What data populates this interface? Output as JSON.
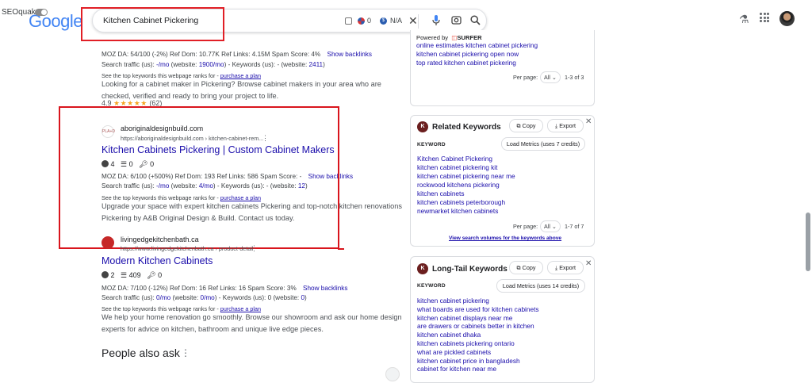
{
  "header": {
    "seoquake_label": "SEOquake",
    "logo_text": "Google",
    "search_query": "Kitchen Cabinet Pickering",
    "pill_count_a": "0",
    "pill_count_b": "N/A"
  },
  "results": {
    "top_partial": {
      "meta_line": "MOZ DA: 54/100 (-2%)   Ref Dom: 10.77K   Ref Links: 4.15M   Spam Score: 4%",
      "show_backlinks": "Show backlinks",
      "traffic_prefix": "Search traffic (us): ",
      "traffic_value": "-/mo",
      "traffic_mid": " (website: ",
      "traffic_website": "1900/mo",
      "traffic_kw": ") - Keywords (us): - (website: ",
      "traffic_kw_value": "2411",
      "traffic_end": ")",
      "top_kw_text": "See the top keywords this webpage ranks for - ",
      "purchase_plan": "purchase a plan",
      "snippet": "Looking for a cabinet maker in Pickering? Browse cabinet makers in your area who are checked, verified and ready to bring your project to life.",
      "rating_value": "4.9",
      "rating_stars": "★★★★★",
      "rating_count": "(62)"
    },
    "aboriginal": {
      "favicon_text": "PLA+D",
      "site_name": "aboriginaldesignbuild.com",
      "site_url": "https://aboriginaldesignbuild.com › kitchen-cabinet-rem...",
      "title": "Kitchen Cabinets Pickering | Custom Cabinet Makers",
      "icon_count_a": "4",
      "icon_count_b": "0",
      "icon_count_c": "0",
      "meta_line": "MOZ DA: 6/100 (+500%)   Ref Dom: 193   Ref Links: 586   Spam Score: -",
      "show_backlinks": "Show backlinks",
      "traffic_prefix": "Search traffic (us): ",
      "traffic_value": "-/mo",
      "traffic_mid": " (website: ",
      "traffic_website": "4/mo",
      "traffic_kw": ") - Keywords (us): - (website: ",
      "traffic_kw_value": "12",
      "traffic_end": ")",
      "top_kw_text": "See the top keywords this webpage ranks for - ",
      "purchase_plan": "purchase a plan",
      "snippet": "Upgrade your space with expert kitchen cabinets Pickering and top-notch kitchen renovations Pickering by A&B Original Design & Build. Contact us today."
    },
    "livingedge": {
      "site_name": "livingedgekitchenbath.ca",
      "site_url": "https://www.livingedgekitchenbath.ca › product-detail",
      "title": "Modern Kitchen Cabinets",
      "icon_count_a": "2",
      "icon_count_b": "409",
      "icon_count_c": "0",
      "meta_line": "MOZ DA: 7/100 (-12%)   Ref Dom: 16   Ref Links: 16   Spam Score: 3%",
      "show_backlinks": "Show backlinks",
      "traffic_prefix": "Search traffic (us): ",
      "traffic_value": "0/mo",
      "traffic_mid": " (website: ",
      "traffic_website": "0/mo",
      "traffic_kw": ") - Keywords (us): 0 (website: ",
      "traffic_kw_value": "0",
      "traffic_end": ")",
      "top_kw_text": "See the top keywords this webpage ranks for - ",
      "purchase_plan": "purchase a plan",
      "snippet": "We help your home renovation go smoothly. Browse our showroom and ask our home design experts for advice on kitchen, bathroom and unique live edge pieces."
    },
    "people_also_ask": "People also ask"
  },
  "sidebar": {
    "top_panel": {
      "powered_by": "Powered by",
      "surfer": "SURFER",
      "keywords": [
        "online estimates kitchen cabinet pickering",
        "kitchen cabinet pickering open now",
        "top rated kitchen cabinet pickering"
      ],
      "per_page_label": "Per page:",
      "per_page_value": "All",
      "range": "1-3 of 3"
    },
    "related": {
      "badge": "K",
      "title": "Related Keywords",
      "copy": "Copy",
      "export": "Export",
      "column": "KEYWORD",
      "load_metrics": "Load Metrics (uses 7 credits)",
      "keywords": [
        "Kitchen Cabinet Pickering",
        "kitchen cabinet pickering kit",
        "kitchen cabinet pickering near me",
        "rockwood kitchens pickering",
        "kitchen cabinets",
        "kitchen cabinets peterborough",
        "newmarket kitchen cabinets"
      ],
      "per_page_label": "Per page:",
      "per_page_value": "All",
      "range": "1-7 of 7",
      "footer_link": "View search volumes for the keywords above"
    },
    "longtail": {
      "badge": "K",
      "title": "Long-Tail Keywords",
      "copy": "Copy",
      "export": "Export",
      "column": "KEYWORD",
      "load_metrics": "Load Metrics (uses 14 credits)",
      "keywords": [
        "kitchen cabinet pickering",
        "what boards are used for kitchen cabinets",
        "kitchen cabinet displays near me",
        "are drawers or cabinets better in kitchen",
        "kitchen cabinet dhaka",
        "kitchen cabinets pickering ontario",
        "what are pickled cabinets",
        "kitchen cabinet price in bangladesh",
        "cabinet for kitchen near me"
      ]
    }
  },
  "colors": {
    "link": "#1a0dab",
    "highlight": "#d9151d",
    "star": "#f5a623"
  }
}
